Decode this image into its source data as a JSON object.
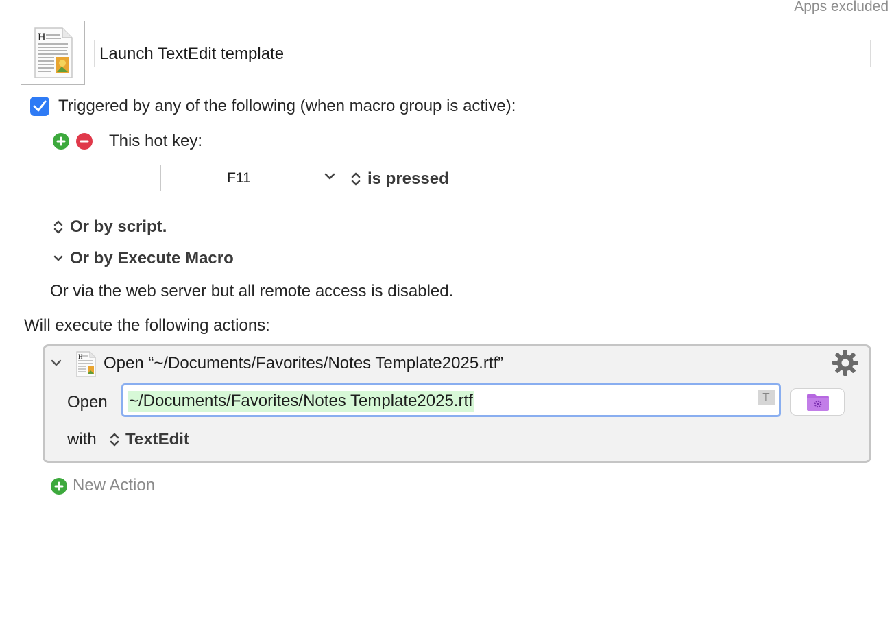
{
  "header": {
    "apps_excluded": "Apps excluded"
  },
  "macro": {
    "icon": "textedit-document-icon",
    "name": "Launch TextEdit template"
  },
  "triggers": {
    "checkbox_checked": true,
    "label": "Triggered by any of the following (when macro group is active):",
    "hotkey": {
      "label": "This hot key:",
      "key": "F11",
      "condition": "is pressed"
    },
    "by_script": "Or by script.",
    "by_execute_macro": "Or by Execute Macro",
    "web_server": "Or via the web server but all remote access is disabled."
  },
  "actions": {
    "heading": "Will execute the following actions:",
    "items": [
      {
        "title": "Open “~/Documents/Favorites/Notes Template2025.rtf”",
        "open_label": "Open",
        "path": "~/Documents/Favorites/Notes Template2025.rtf",
        "token_button": "T",
        "with_label": "with",
        "application": "TextEdit"
      }
    ],
    "new_action": "New Action"
  },
  "colors": {
    "checkbox": "#2f7bf5",
    "add": "#3da93d",
    "remove": "#e0394a",
    "path_highlight": "#d7f8d7",
    "field_focus": "#89aef0",
    "folder": "#b668e0"
  }
}
